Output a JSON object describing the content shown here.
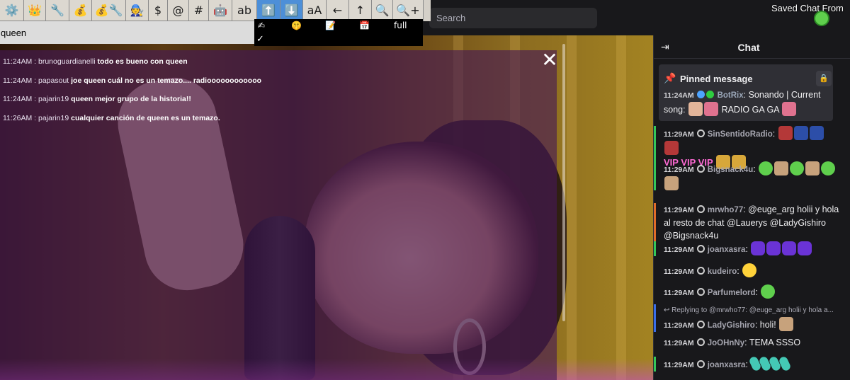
{
  "toolbar": {
    "buttons": [
      {
        "name": "gear-icon",
        "glyph": "⚙️",
        "width": 34
      },
      {
        "name": "crown-icon",
        "glyph": "👑",
        "width": 31
      },
      {
        "name": "wrench-icon",
        "glyph": "🔧",
        "width": 33
      },
      {
        "name": "money-bag-icon",
        "glyph": "💰",
        "width": 32
      },
      {
        "name": "money-bag-wrench-icon",
        "glyph": "💰🔧",
        "width": 48
      },
      {
        "name": "person-icon",
        "glyph": "🧑‍🔧",
        "width": 32
      },
      {
        "name": "dollar-icon",
        "glyph": "$",
        "width": 27
      },
      {
        "name": "at-icon",
        "glyph": "@",
        "width": 30
      },
      {
        "name": "hash-icon",
        "glyph": "#",
        "width": 28
      },
      {
        "name": "robot-icon",
        "glyph": "🤖",
        "width": 33
      },
      {
        "name": "ab-icon",
        "glyph": "ab",
        "width": 35
      },
      {
        "name": "arrow-up-box-icon",
        "glyph": "⬆️",
        "width": 33,
        "blue": true
      },
      {
        "name": "arrow-down-box-icon",
        "glyph": "⬇️",
        "width": 32,
        "blue": true
      },
      {
        "name": "font-size-icon",
        "glyph": "aA",
        "width": 33
      },
      {
        "name": "arrow-left-icon",
        "glyph": "←",
        "width": 32
      },
      {
        "name": "arrow-up-icon",
        "glyph": "↑",
        "width": 32
      },
      {
        "name": "zoom-out-icon",
        "glyph": "🔍",
        "width": 30
      },
      {
        "name": "zoom-in-icon",
        "glyph": "🔍+",
        "width": 43
      }
    ],
    "filter_value": "queen",
    "strip": {
      "items": [
        "✍",
        "🤫",
        "📝",
        "📅",
        "full"
      ],
      "check": "✓"
    }
  },
  "search": {
    "placeholder": "Search"
  },
  "saved_chat_from": "Saved Chat From",
  "overlay": {
    "close": "✕",
    "lines": [
      {
        "time": "11:24AM",
        "user": "brunoguardianelli",
        "text": "todo es bueno con queen"
      },
      {
        "time": "11:24AM",
        "user": "papasout",
        "text": "joe queen cuál no es un temazo.... radioooooooooooo"
      },
      {
        "time": "11:24AM",
        "user": "pajarin19",
        "text": "queen mejor grupo de la historia!!"
      },
      {
        "time": "11:26AM",
        "user": "pajarin19",
        "text": "cualquier canción de queen es un temazo."
      }
    ]
  },
  "chat": {
    "title": "Chat",
    "collapse_icon": "⇥",
    "pinned": {
      "label": "Pinned message",
      "time": "11:24AM",
      "user": "BotRix",
      "text_a": "Sonando | Current song:",
      "text_b": "RADIO GA GA",
      "user_color": "#9aa6b8"
    },
    "messages": [
      {
        "time": "11:29AM",
        "user": "SinSentidoRadio",
        "color": "#a6a6b0",
        "text": "",
        "bar": "green",
        "emotes": [
          "red",
          "navy",
          "navy",
          "red"
        ],
        "extra": "VIP VIP VIP"
      },
      {
        "time": "11:29AM",
        "user": "Bigsnack4u",
        "color": "#a6a6b0",
        "text": "",
        "bar": "green",
        "emotes": [
          "green",
          "cat",
          "green",
          "cat",
          "green",
          "cat"
        ]
      },
      {
        "time": "11:29AM",
        "user": "mrwho77",
        "color": "#a6a6b0",
        "text": "@euge_arg holii y hola al resto de chat @Lauerys @LadyGishiro @Bigsnack4u",
        "bar": "orange"
      },
      {
        "time": "11:29AM",
        "user": "joanxasra",
        "color": "#a6a6b0",
        "text": "",
        "bar": "green",
        "emotes": [
          "purple",
          "purple",
          "purple",
          "purple"
        ]
      },
      {
        "time": "11:29AM",
        "user": "kudeiro",
        "color": "#a6a6b0",
        "text": "",
        "bar": "none",
        "emotes": [
          "bee"
        ]
      },
      {
        "time": "11:29AM",
        "user": "Parfumelord",
        "color": "#a6a6b0",
        "text": "",
        "bar": "none",
        "emotes": [
          "green"
        ]
      },
      {
        "time": "11:29AM",
        "user": "LadyGishiro",
        "color": "#a6a6b0",
        "text": "holi!",
        "bar": "blue",
        "reply": "Replying to @mrwho77: @euge_arg holii y hola a...",
        "emotes": [
          "cat"
        ]
      },
      {
        "time": "11:29AM",
        "user": "JoOHnNy",
        "color": "#a6a6b0",
        "text": "TEMA SSSO",
        "bar": "none"
      },
      {
        "time": "11:29AM",
        "user": "joanxasra",
        "color": "#a6a6b0",
        "text": "",
        "bar": "green",
        "emotes": [
          "mint",
          "mint",
          "mint",
          "mint"
        ]
      }
    ]
  }
}
